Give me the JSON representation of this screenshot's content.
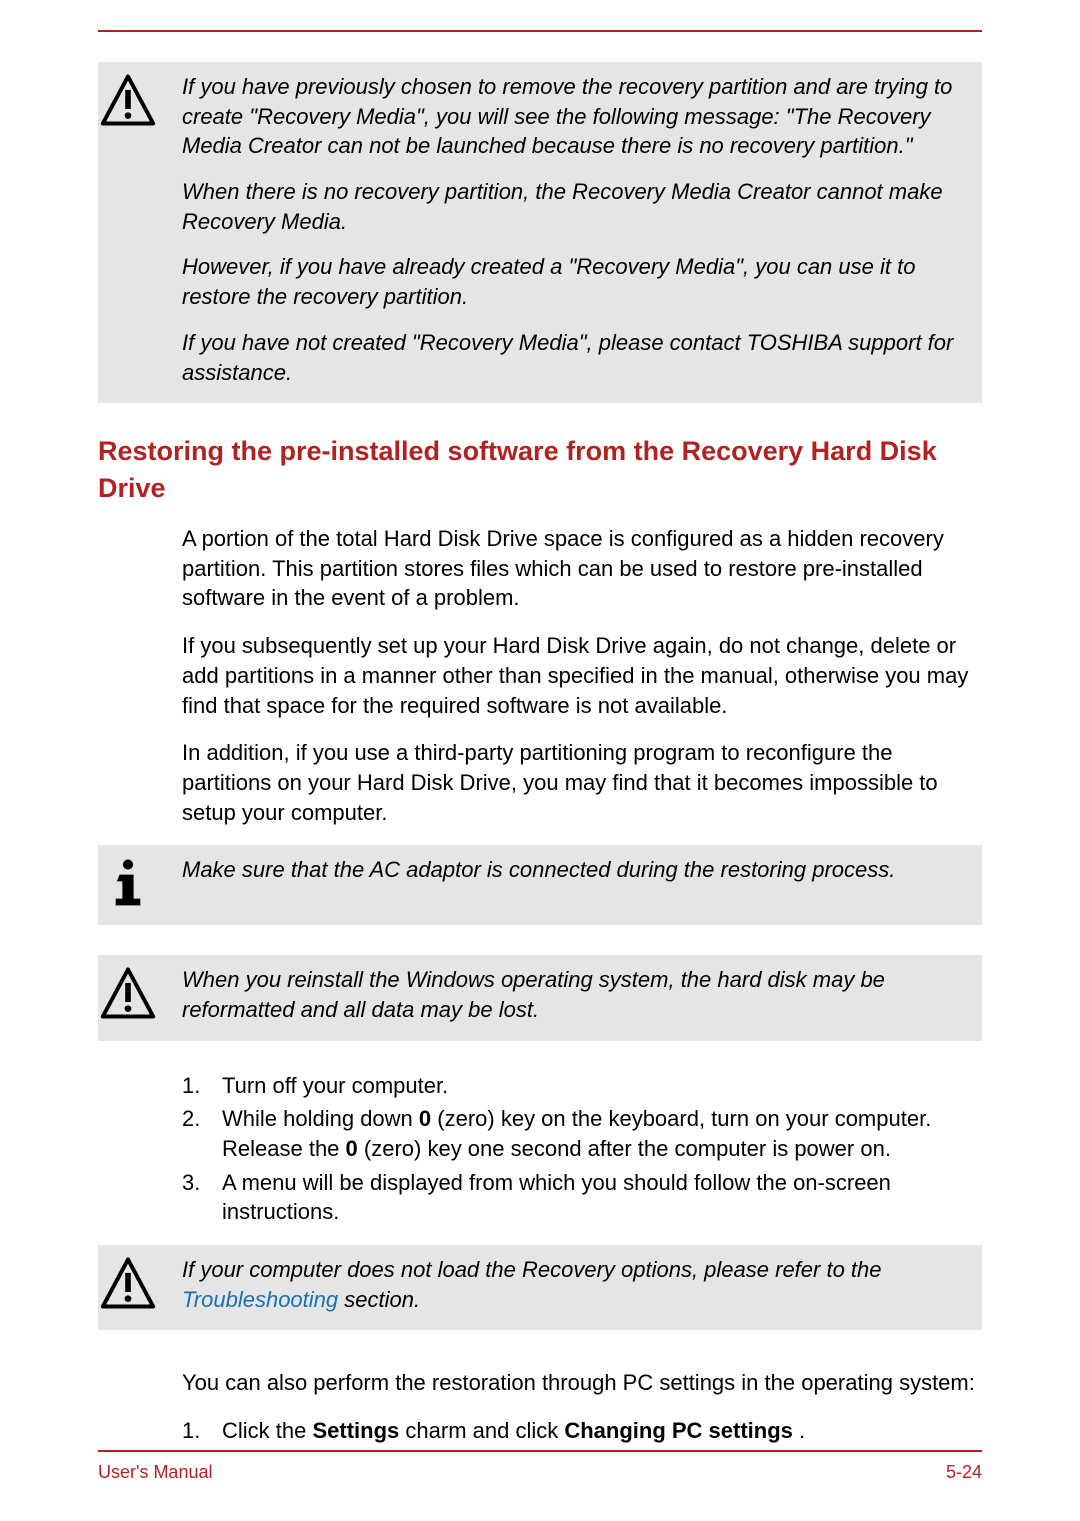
{
  "callout1": {
    "p1": "If you have previously chosen to remove the recovery partition and are trying to create \"Recovery Media\", you will see the following message: \"The Recovery Media Creator can not be launched because there is no recovery partition.\"",
    "p2": "When there is no recovery partition, the Recovery Media Creator cannot make Recovery Media.",
    "p3": "However, if you have already created a \"Recovery Media\", you can use it to restore the recovery partition.",
    "p4": "If you have not created \"Recovery Media\", please contact TOSHIBA support for assistance."
  },
  "heading": "Restoring the pre-installed software from the Recovery Hard Disk Drive",
  "para1": "A portion of the total Hard Disk Drive space is configured as a hidden recovery partition. This partition stores files which can be used to restore pre-installed software in the event of a problem.",
  "para2": "If you subsequently set up your Hard Disk Drive again, do not change, delete or add partitions in a manner other than specified in the manual, otherwise you may find that space for the required software is not available.",
  "para3": "In addition, if you use a third-party partitioning program to reconfigure the partitions on your Hard Disk Drive, you may find that it becomes impossible to setup your computer.",
  "callout2": {
    "p1": "Make sure that the AC adaptor is connected during the restoring process."
  },
  "callout3": {
    "p1": "When you reinstall the Windows operating system, the hard disk may be reformatted and all data may be lost."
  },
  "steps": {
    "n1": "1.",
    "t1": "Turn off your computer.",
    "n2": "2.",
    "t2a": "While holding down ",
    "t2b": "0",
    "t2c": " (zero) key on the keyboard, turn on your computer. Release the ",
    "t2d": "0",
    "t2e": " (zero) key one second after the computer is power on.",
    "n3": "3.",
    "t3": "A menu will be displayed from which you should follow the on-screen instructions."
  },
  "callout4": {
    "pre": "If your computer does not load the Recovery options, please refer to the ",
    "link": "Troubleshooting",
    "post": " section."
  },
  "para4": "You can also perform the restoration through PC settings in the operating system:",
  "steps2": {
    "n1": "1.",
    "t1a": "Click the ",
    "t1b": "Settings",
    "t1c": " charm and click ",
    "t1d": "Changing PC settings",
    "t1e": " ."
  },
  "footer": {
    "left": "User's Manual",
    "right": "5-24"
  }
}
